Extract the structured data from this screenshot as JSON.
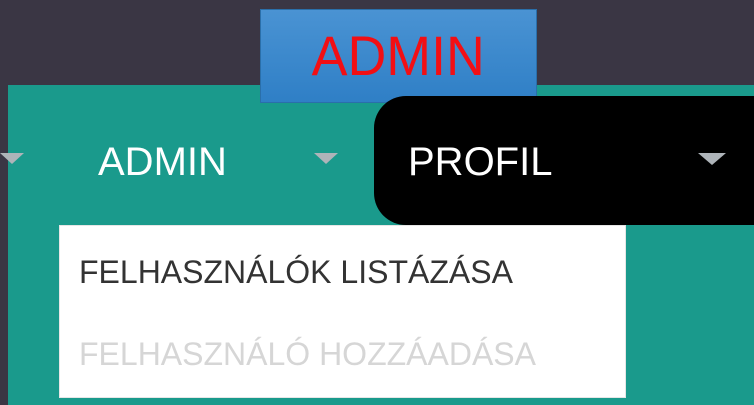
{
  "badge": {
    "label": "ADMIN"
  },
  "nav": {
    "admin_label": "ADMIN",
    "profile_label": "PROFIL"
  },
  "dropdown": {
    "items": [
      {
        "label": "FELHASZNÁLÓK LISTÁZÁSA",
        "state": "enabled"
      },
      {
        "label": "FELHASZNÁLÓ HOZZÁADÁSA",
        "state": "disabled"
      }
    ]
  },
  "colors": {
    "background": "#3a3644",
    "teal": "#1a9a8c",
    "badge_blue": "#2f7fc6",
    "badge_text": "#f20f14",
    "profile_bg": "#000000",
    "menu_text": "#333333",
    "menu_disabled": "#d6d6d6"
  },
  "icons": {
    "left_caret": "chevron-down-icon",
    "admin_caret": "chevron-down-icon",
    "profile_caret": "chevron-down-icon"
  }
}
